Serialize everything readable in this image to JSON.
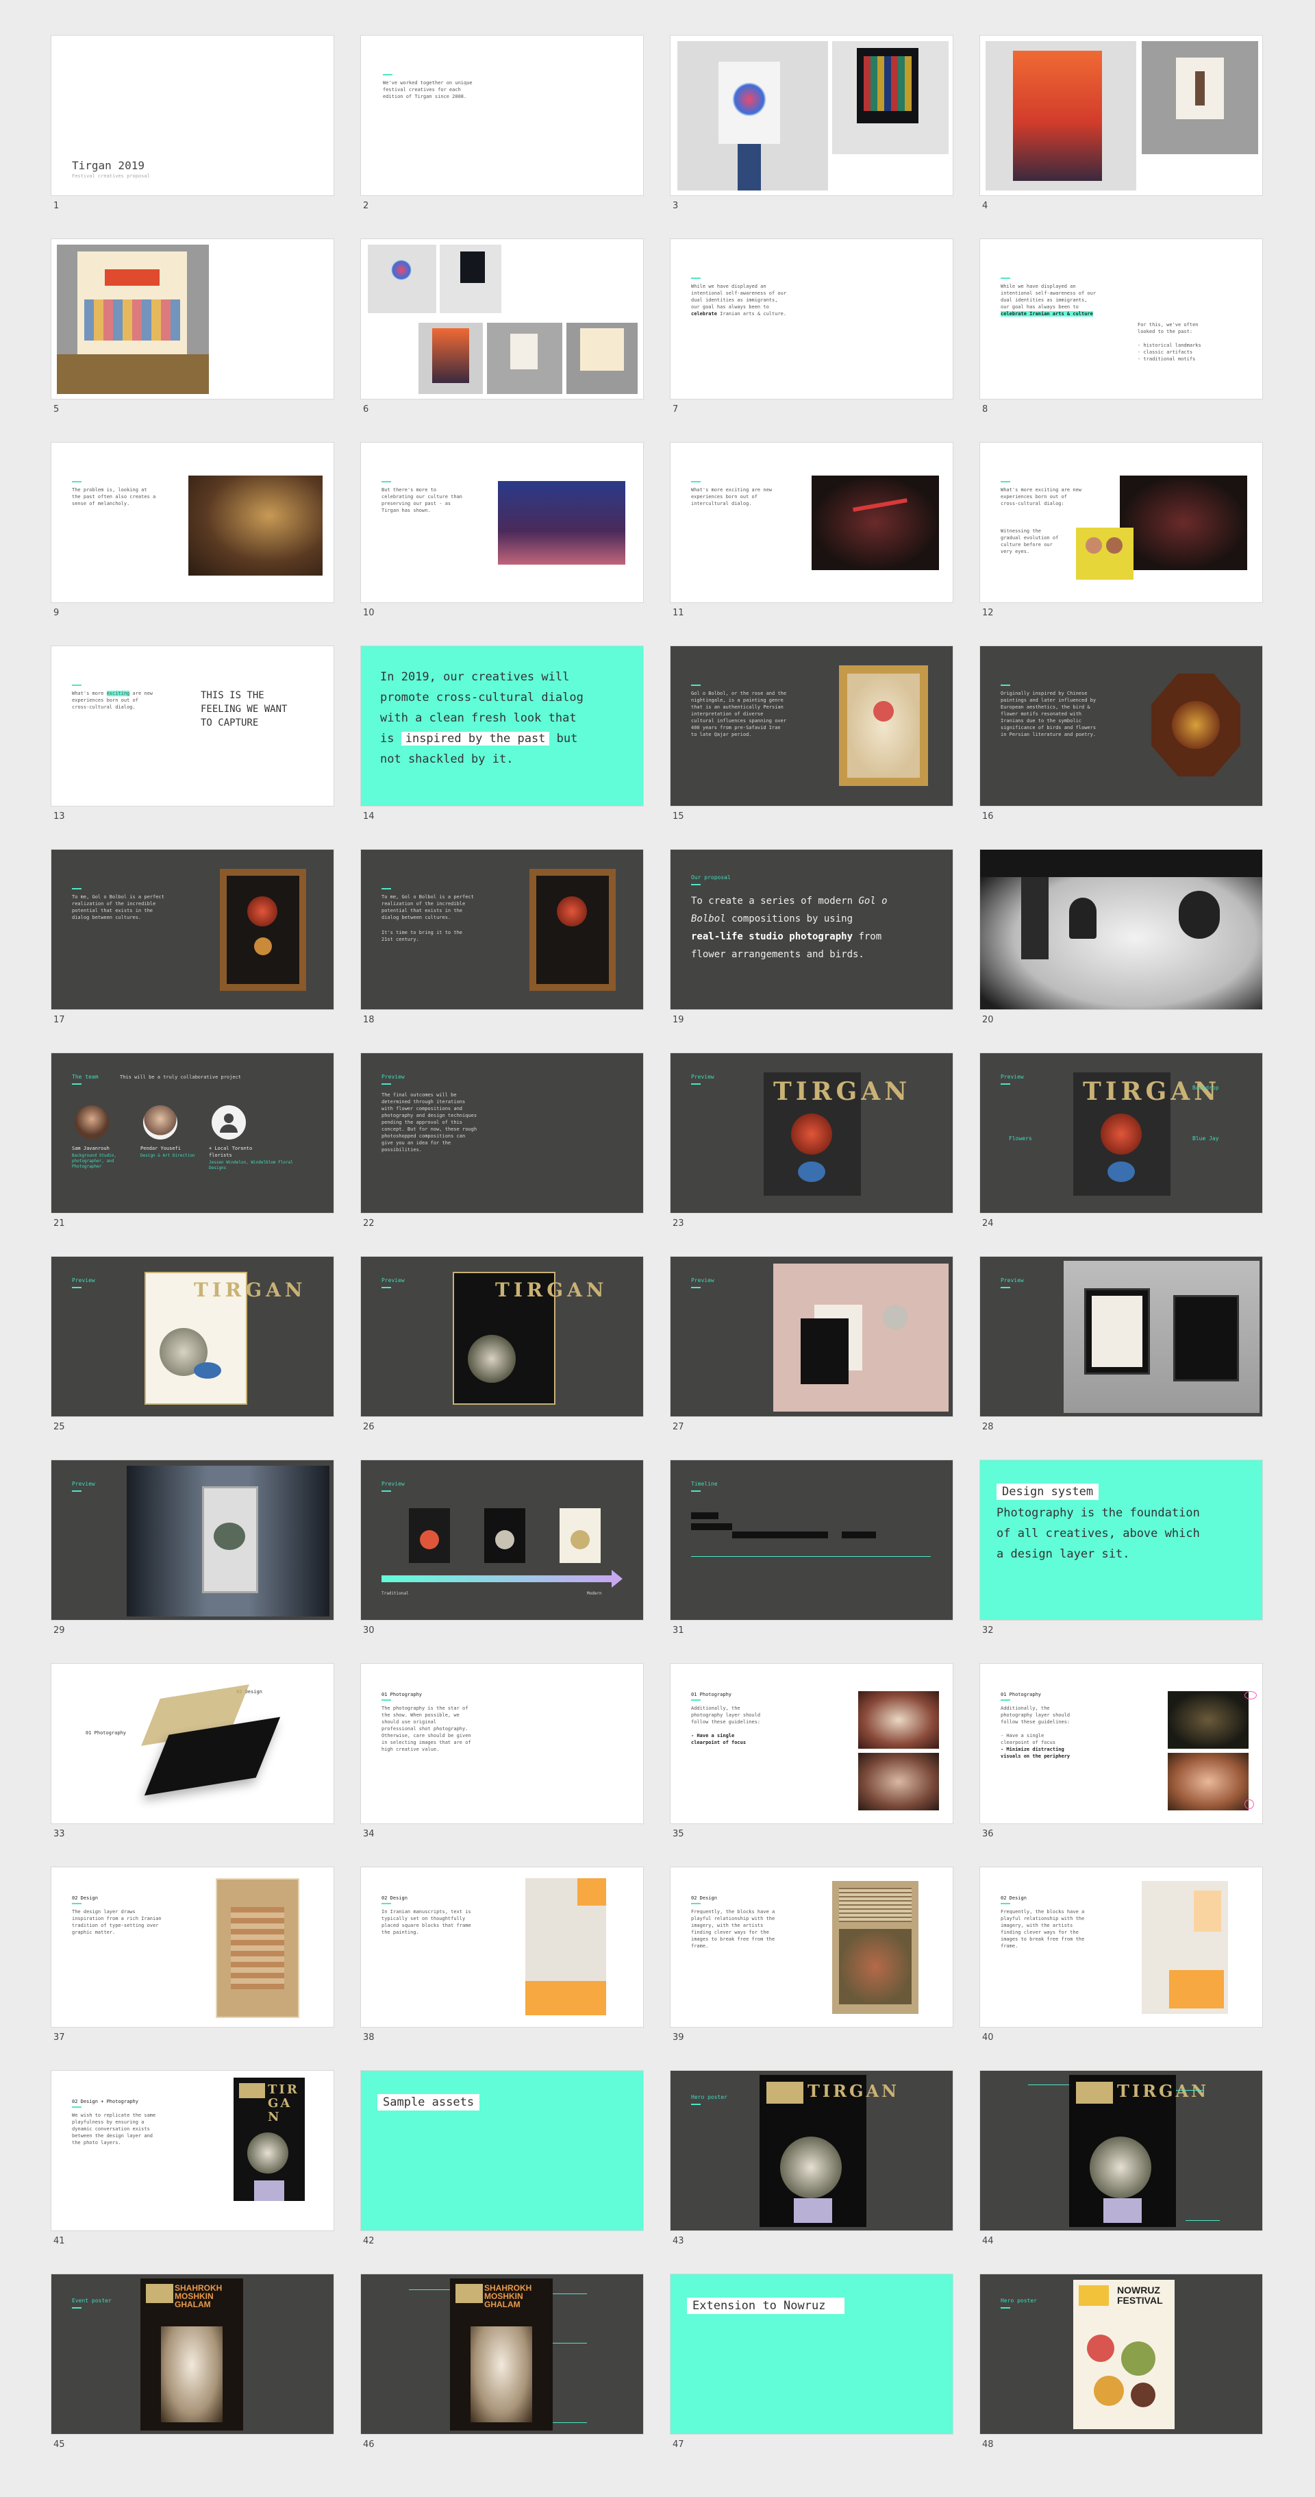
{
  "slides": [
    {
      "n": "1",
      "title": "Tirgan 2019",
      "subtitle": "Festival creatives proposal"
    },
    {
      "n": "2",
      "text": "We've worked together on unique\nfestival creatives for each\nedition of Tirgan since 2008."
    },
    {
      "n": "3"
    },
    {
      "n": "4"
    },
    {
      "n": "5"
    },
    {
      "n": "6"
    },
    {
      "n": "7",
      "text": "While we have displayed an\nintentional self-awareness of our\ndual identities as immigrants,\nour goal has always been to",
      "strong": "celebrate",
      "rest": " Iranian arts & culture."
    },
    {
      "n": "8",
      "text": "While we have displayed an\nintentional self-awareness of our\ndual identities as immigrants,\nour goal has always been to",
      "strong": "celebrate Iranian arts & culture",
      "side": "For this, we've often\nlooked to the past:\n\n- historical landmarks\n- classic artifacts\n- traditional motifs"
    },
    {
      "n": "9",
      "text": "The problem is, looking at\nthe past often also creates a\nsense of melancholy."
    },
    {
      "n": "10",
      "text": "But there's more to\ncelebrating our culture than\npreserving our past - as\nTirgan has shown."
    },
    {
      "n": "11",
      "text": "What's more exciting are new\nexperiences born out of\nintercultural dialog."
    },
    {
      "n": "12",
      "text": "What's more exciting are new\nexperiences born out of\ncross-cultural dialog:",
      "text2": "Witnessing the\ngradual evolution of\nculture before our\nvery eyes."
    },
    {
      "n": "13",
      "pre": "What's more",
      "mark": "exciting",
      "post": " are new\nexperiences born out of\ncross-cultural dialog.",
      "feeling": "THIS IS THE\nFEELING WE WANT\nTO CAPTURE"
    },
    {
      "n": "14",
      "a": "In 2019, our creatives will\npromote cross-cultural dialog\nwith a clean fresh look that\nis ",
      "b": "inspired by the past",
      "c": " but\nnot shackled by it."
    },
    {
      "n": "15",
      "text": "Gol o Bolbol, or the rose and the\nnightingale, is a painting genre\nthat is an authentically Persian\ninterpretation of diverse\ncultural influences spanning over\n400 years from pre-Safavid Iran\nto late Qajar period."
    },
    {
      "n": "16",
      "text": "Originally inspired by Chinese\npaintings and later influenced by\nEuropean aesthetics, the bird &\nflower motifs resonated with\nIranians due to the symbolic\nsignificance of birds and flowers\nin Persian literature and poetry."
    },
    {
      "n": "17",
      "text": "To me, Gol o Bolbol is a perfect\nrealization of the incredible\npotential that exists in the\ndialog between cultures."
    },
    {
      "n": "18",
      "text": "To me, Gol o Bolbol is a perfect\nrealization of the incredible\npotential that exists in the\ndialog between cultures.",
      "text2": "It's time to bring it to the\n21st century."
    },
    {
      "n": "19",
      "label": "Our proposal",
      "a": "To create a series of modern ",
      "i": "Gol o\nBolbol",
      "b": " compositions by using\n",
      "strong": "real-life studio photography",
      "c": " from\nflower arrangements and birds."
    },
    {
      "n": "20"
    },
    {
      "n": "21",
      "label": "The team",
      "intro": "This will be a truly collaborative project",
      "people": [
        {
          "name": "Sam Javanrouh",
          "role": "Background Studio,\nphotographer, and\nPhotographer"
        },
        {
          "name": "Pendar Yousefi",
          "role": "Design & Art Direction"
        },
        {
          "name": "+ Local Toronto\nflorists",
          "role": "Jessen Windelon, Windelblom Floral\nDesigns"
        }
      ]
    },
    {
      "n": "22",
      "label": "Preview",
      "text": "The final outcomes will be\ndetermined through iterations\nwith flower compositions and\nphotography and design techniques\npending the approval of this\nconcept. But for now, these rough\nphotoshopped compositions can\ngive you an idea for the\npossibilities."
    },
    {
      "n": "23",
      "label": "Preview",
      "wordmark": "TIRGAN"
    },
    {
      "n": "24",
      "label": "Preview",
      "wordmark": "TIRGAN",
      "callouts": [
        "Backdrop",
        "Flowers",
        "Blue Jay"
      ]
    },
    {
      "n": "25",
      "label": "Preview",
      "wordmark": "TIRGAN"
    },
    {
      "n": "26",
      "label": "Preview",
      "wordmark": "TIRGAN"
    },
    {
      "n": "27",
      "label": "Preview"
    },
    {
      "n": "28",
      "label": "Preview"
    },
    {
      "n": "29",
      "label": "Preview"
    },
    {
      "n": "30",
      "label": "Preview",
      "left": "Traditional",
      "right": "Modern"
    },
    {
      "n": "31",
      "label": "Timeline"
    },
    {
      "n": "32",
      "chip": "Design system",
      "text": "Photography is the foundation\nof all creatives, above which\na design layer sit."
    },
    {
      "n": "33",
      "design": "02 Design",
      "photo": "01 Photography"
    },
    {
      "n": "34",
      "label": "01 Photography",
      "text": "The photography is the star of\nthe show. When possible, we\nshould use original\nprofessional shot photography.\nOtherwise, care should be given\nin selecting images that are of\nhigh creative value."
    },
    {
      "n": "35",
      "label": "01 Photography",
      "text": "Additionally, the\nphotography layer should\nfollow these guidelines:",
      "strong": "- Have a single\nclearpoint of focus"
    },
    {
      "n": "36",
      "label": "01 Photography",
      "text": "Additionally, the\nphotography layer should\nfollow these guidelines:\n\n- Have a single\nclearpoint of focus",
      "strong": "- Minimize distracting\nvisuals on the periphery"
    },
    {
      "n": "37",
      "label": "02 Design",
      "text": "The design layer draws\ninspiration from a rich Iranian\ntradition of type-setting over\ngraphic matter."
    },
    {
      "n": "38",
      "label": "02 Design",
      "text": "In Iranian manuscripts, text is\ntypically set on thoughtfully\nplaced square blocks that frame\nthe painting."
    },
    {
      "n": "39",
      "label": "02 Design",
      "text": "Frequently, the blocks have a\nplayful relationship with the\nimagery, with the artists\nfinding clever ways for the\nimages to break free from the\nframe."
    },
    {
      "n": "40",
      "label": "02 Design",
      "text": "Frequently, the blocks have a\nplayful relationship with the\nimagery, with the artists\nfinding clever ways for the\nimages to break free from the\nframe."
    },
    {
      "n": "41",
      "label": "02 Design + Photography",
      "text": "We wish to replicate the same\nplayfulness by ensuring a\ndynamic conversation exists\nbetween the design layer and\nthe photo layers."
    },
    {
      "n": "42",
      "chip": "Sample assets"
    },
    {
      "n": "43",
      "label": "Hero poster",
      "wordmark": "TIRGAN"
    },
    {
      "n": "44",
      "wordmark": "TIRGAN"
    },
    {
      "n": "45",
      "label": "Event poster",
      "poster": "SHAHROKH\nMOSHKIN\nGHALAM"
    },
    {
      "n": "46",
      "poster": "SHAHROKH\nMOSHKIN\nGHALAM"
    },
    {
      "n": "47",
      "chip": "Extension to Nowruz"
    },
    {
      "n": "48",
      "label": "Hero poster",
      "poster": "NOWRUZ\nFESTIVAL"
    }
  ],
  "colors": {
    "mint": "#61fcd8",
    "dark": "#444443",
    "gold": "#c9b274",
    "orange": "#f7a840"
  }
}
